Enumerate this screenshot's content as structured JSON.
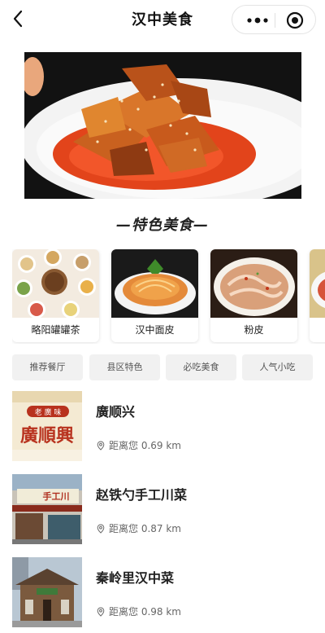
{
  "app": {
    "title": "汉中美食"
  },
  "section": {
    "title": "—特色美食—"
  },
  "featured": [
    {
      "label": "略阳罐罐茶"
    },
    {
      "label": "汉中面皮"
    },
    {
      "label": "粉皮"
    }
  ],
  "tags": [
    "推荐餐厅",
    "县区特色",
    "必吃美食",
    "人气小吃"
  ],
  "restaurants": [
    {
      "name": "廣顺兴",
      "distance": "距离您 0.69 km",
      "sign_text": "廣順興",
      "sign_small": "老 廣 味"
    },
    {
      "name": "赵铁勺手工川菜",
      "distance": "距离您 0.87 km",
      "sign_text": "手工川"
    },
    {
      "name": "秦岭里汉中菜",
      "distance": "距离您 0.98 km",
      "sign_text": ""
    }
  ],
  "colors": {
    "accent": "#d9230f",
    "tag_bg": "#f1f1f1"
  }
}
